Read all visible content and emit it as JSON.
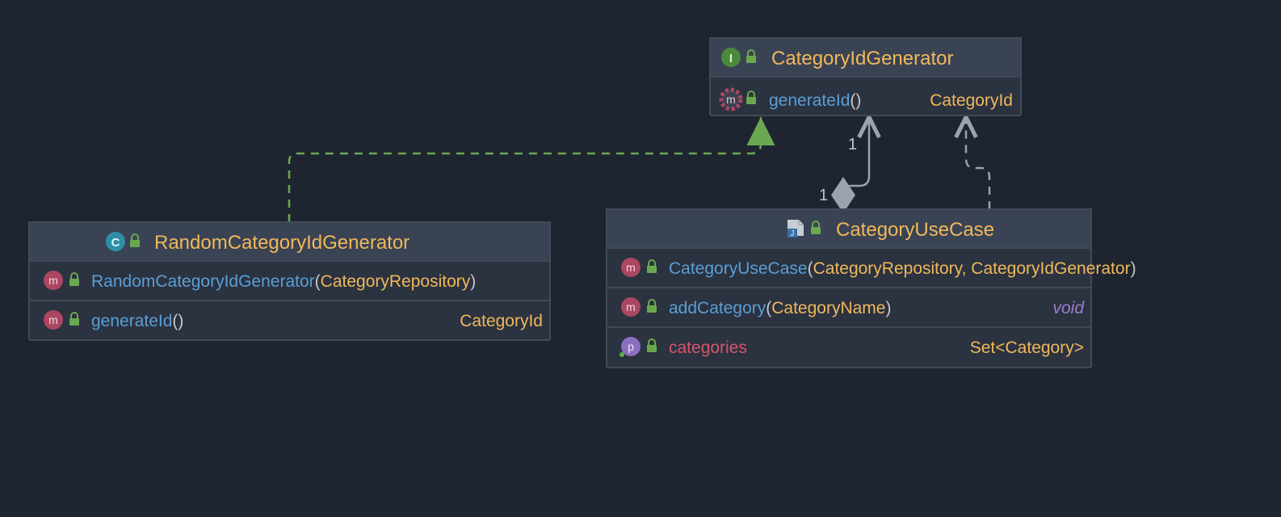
{
  "classes": {
    "iface": {
      "kind": "interface",
      "kindIcon": "I",
      "name": "CategoryIdGenerator",
      "members": [
        {
          "icon": "m",
          "abstract": true,
          "name": "generateId",
          "params": "",
          "ret": "CategoryId"
        }
      ]
    },
    "rand": {
      "kind": "class",
      "kindIcon": "C",
      "name": "RandomCategoryIdGenerator",
      "members": [
        {
          "icon": "m",
          "name": "RandomCategoryIdGenerator",
          "params": "CategoryRepository",
          "ret": ""
        },
        {
          "icon": "m",
          "name": "generateId",
          "params": "",
          "ret": "CategoryId"
        }
      ]
    },
    "uc": {
      "kind": "javaclass",
      "kindIcon": "J",
      "name": "CategoryUseCase",
      "members": [
        {
          "icon": "m",
          "name": "CategoryUseCase",
          "params": "CategoryRepository, CategoryIdGenerator",
          "ret": ""
        },
        {
          "icon": "m",
          "name": "addCategory",
          "params": "CategoryName",
          "ret": "void",
          "retStyle": "void"
        },
        {
          "icon": "p",
          "name": "categories",
          "isProp": true,
          "ret": "Set<Category>"
        }
      ]
    }
  },
  "relations": {
    "implements": {
      "from": "rand",
      "to": "iface",
      "label": ""
    },
    "aggregation": {
      "from": "uc",
      "to": "iface",
      "mult_from": "1",
      "mult_to": "1"
    },
    "dependency": {
      "from": "uc",
      "to": "iface"
    }
  }
}
